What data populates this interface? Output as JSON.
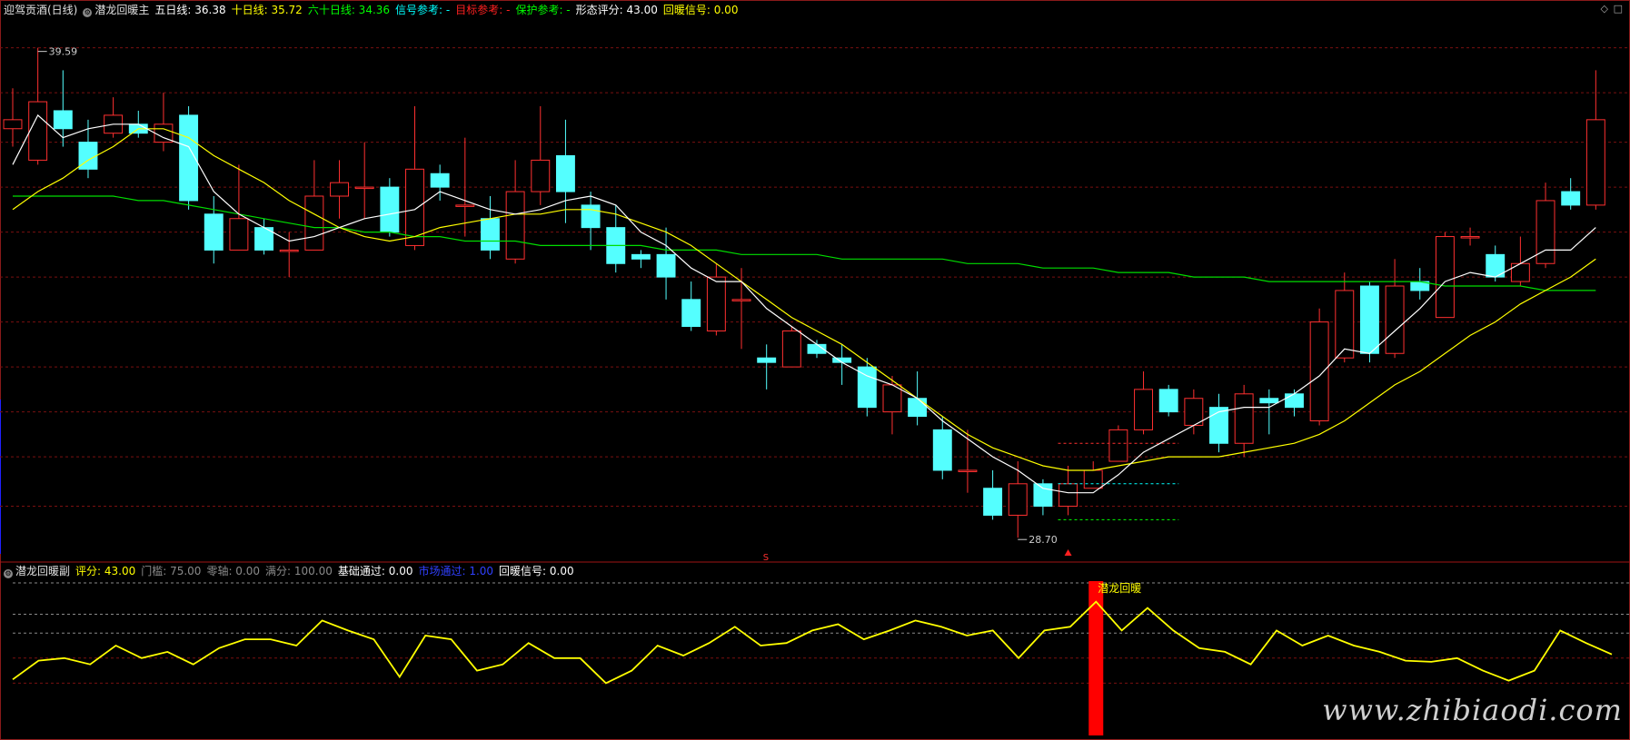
{
  "main_header": {
    "stock_name": "迎驾贡酒(日线)",
    "indicator_name": "潜龙回暖主",
    "items": [
      {
        "label": "五日线: 36.38",
        "color": "#ffffff"
      },
      {
        "label": "十日线: 35.72",
        "color": "#ffff00"
      },
      {
        "label": "六十日线: 34.36",
        "color": "#00ff00"
      },
      {
        "label": "信号参考: -",
        "color": "#00ffff"
      },
      {
        "label": "目标参考: -",
        "color": "#ff2020"
      },
      {
        "label": "保护参考: -",
        "color": "#00ff00"
      },
      {
        "label": "形态评分: 43.00",
        "color": "#ffffff"
      },
      {
        "label": "回暖信号: 0.00",
        "color": "#ffff00"
      }
    ]
  },
  "sub_header": {
    "indicator_name": "潜龙回暖副",
    "items": [
      {
        "label": "评分: 43.00",
        "color": "#ffff00"
      },
      {
        "label": "门槛: 75.00",
        "color": "#8a8a8a"
      },
      {
        "label": "零轴: 0.00",
        "color": "#8a8a8a"
      },
      {
        "label": "满分: 100.00",
        "color": "#8a8a8a"
      },
      {
        "label": "基础通过: 0.00",
        "color": "#ffffff"
      },
      {
        "label": "市场通过: 1.00",
        "color": "#3040ff"
      },
      {
        "label": "回暖信号: 0.00",
        "color": "#ffffff"
      }
    ]
  },
  "annotations": {
    "high_label": "39.59",
    "low_label": "28.70",
    "signal_label": "潜龙回暖",
    "s_marker": "S"
  },
  "watermark": "www.zhibiaodi.com",
  "colors": {
    "up": "#ff3030",
    "down": "#54ffff",
    "ma5": "#ffffff",
    "ma10": "#ffff00",
    "ma60": "#00dd00",
    "score": "#ffff00",
    "signal_bar": "#ff0000",
    "grid": "#7a1010"
  },
  "chart_data": [
    {
      "type": "candlestick",
      "title": "潜龙回暖主",
      "y_range": [
        28.3,
        40.3
      ],
      "candles": [
        [
          37.8,
          38.0,
          37.4,
          38.7
        ],
        [
          37.1,
          38.4,
          37.0,
          39.6
        ],
        [
          38.2,
          37.8,
          37.4,
          39.1
        ],
        [
          37.5,
          36.9,
          36.7,
          38.0
        ],
        [
          37.7,
          38.1,
          37.6,
          38.5
        ],
        [
          37.9,
          37.7,
          37.6,
          38.2
        ],
        [
          37.5,
          37.9,
          37.3,
          38.6
        ],
        [
          38.1,
          36.2,
          36.0,
          38.3
        ],
        [
          35.9,
          35.1,
          34.8,
          36.3
        ],
        [
          35.1,
          35.8,
          35.1,
          37.0
        ],
        [
          35.6,
          35.1,
          35.0,
          35.8
        ],
        [
          35.1,
          35.1,
          34.5,
          35.5
        ],
        [
          35.1,
          36.3,
          35.1,
          37.1
        ],
        [
          36.3,
          36.6,
          35.8,
          37.1
        ],
        [
          36.5,
          36.5,
          35.8,
          37.5
        ],
        [
          36.5,
          35.5,
          35.4,
          36.7
        ],
        [
          35.2,
          36.9,
          35.1,
          38.3
        ],
        [
          36.8,
          36.5,
          36.2,
          37.0
        ],
        [
          36.1,
          36.1,
          35.4,
          37.6
        ],
        [
          35.8,
          35.1,
          34.9,
          36.3
        ],
        [
          34.9,
          36.4,
          34.8,
          37.1
        ],
        [
          36.4,
          37.1,
          36.1,
          38.3
        ],
        [
          37.2,
          36.4,
          35.7,
          38.0
        ],
        [
          36.1,
          35.6,
          35.1,
          36.4
        ],
        [
          35.6,
          34.8,
          34.6,
          36.1
        ],
        [
          35.0,
          34.9,
          34.7,
          35.1
        ],
        [
          35.0,
          34.5,
          34.0,
          35.6
        ],
        [
          34.0,
          33.4,
          33.3,
          34.4
        ],
        [
          33.3,
          34.5,
          33.2,
          34.8
        ],
        [
          34.0,
          34.0,
          32.9,
          34.7
        ],
        [
          32.7,
          32.6,
          32.0,
          33.0
        ],
        [
          32.5,
          33.3,
          32.5,
          33.4
        ],
        [
          33.0,
          32.8,
          32.7,
          33.1
        ],
        [
          32.7,
          32.6,
          32.1,
          33.0
        ],
        [
          32.5,
          31.6,
          31.4,
          32.7
        ],
        [
          31.5,
          32.1,
          31.0,
          32.3
        ],
        [
          31.8,
          31.4,
          31.2,
          32.4
        ],
        [
          31.1,
          30.2,
          30.0,
          31.4
        ],
        [
          30.2,
          30.2,
          29.7,
          31.1
        ],
        [
          29.8,
          29.2,
          29.1,
          30.2
        ],
        [
          29.2,
          29.9,
          28.7,
          30.4
        ],
        [
          29.9,
          29.4,
          29.2,
          30.0
        ],
        [
          29.4,
          29.9,
          29.2,
          30.3
        ],
        [
          29.8,
          30.2,
          29.8,
          30.4
        ],
        [
          30.4,
          31.1,
          30.4,
          31.2
        ],
        [
          31.1,
          32.0,
          31.0,
          32.4
        ],
        [
          32.0,
          31.5,
          31.4,
          32.1
        ],
        [
          31.2,
          31.8,
          31.0,
          32.0
        ],
        [
          31.6,
          30.8,
          30.6,
          31.9
        ],
        [
          30.8,
          31.9,
          30.5,
          32.1
        ],
        [
          31.8,
          31.7,
          31.0,
          32.0
        ],
        [
          31.9,
          31.6,
          31.4,
          32.0
        ],
        [
          31.3,
          33.5,
          31.2,
          33.8
        ],
        [
          32.7,
          34.2,
          32.6,
          34.6
        ],
        [
          34.3,
          32.8,
          32.6,
          34.4
        ],
        [
          32.8,
          34.3,
          32.7,
          34.9
        ],
        [
          34.4,
          34.2,
          34.0,
          34.7
        ],
        [
          33.6,
          35.4,
          33.6,
          35.5
        ],
        [
          35.4,
          35.4,
          35.2,
          35.6
        ],
        [
          35.0,
          34.5,
          34.4,
          35.2
        ],
        [
          34.4,
          34.8,
          34.3,
          35.4
        ],
        [
          34.8,
          36.2,
          34.7,
          36.6
        ],
        [
          36.4,
          36.1,
          36.0,
          36.7
        ],
        [
          36.1,
          38.0,
          36.0,
          39.1
        ]
      ],
      "ma5": [
        37.0,
        38.1,
        37.6,
        37.8,
        37.9,
        37.9,
        37.6,
        37.4,
        36.4,
        35.9,
        35.6,
        35.3,
        35.4,
        35.6,
        35.8,
        35.9,
        36.0,
        36.4,
        36.2,
        36.0,
        35.9,
        36.0,
        36.2,
        36.3,
        36.1,
        35.5,
        35.2,
        34.7,
        34.4,
        34.4,
        33.8,
        33.4,
        33.0,
        32.6,
        32.3,
        32.1,
        31.8,
        31.3,
        30.9,
        30.5,
        30.2,
        29.8,
        29.7,
        29.7,
        30.1,
        30.6,
        30.9,
        31.2,
        31.5,
        31.6,
        31.6,
        31.9,
        32.3,
        32.9,
        32.8,
        33.3,
        33.8,
        34.4,
        34.6,
        34.5,
        34.8,
        35.1,
        35.1,
        35.6
      ],
      "ma10": [
        36.0,
        36.4,
        36.7,
        37.1,
        37.4,
        37.8,
        37.8,
        37.6,
        37.2,
        36.9,
        36.6,
        36.2,
        35.9,
        35.6,
        35.4,
        35.3,
        35.4,
        35.6,
        35.7,
        35.8,
        35.9,
        35.9,
        36.0,
        36.0,
        35.9,
        35.7,
        35.5,
        35.2,
        34.8,
        34.4,
        34.0,
        33.6,
        33.3,
        33.0,
        32.6,
        32.2,
        31.8,
        31.4,
        31.0,
        30.7,
        30.5,
        30.3,
        30.2,
        30.2,
        30.3,
        30.4,
        30.5,
        30.5,
        30.5,
        30.6,
        30.7,
        30.8,
        31.0,
        31.3,
        31.7,
        32.1,
        32.4,
        32.8,
        33.2,
        33.5,
        33.9,
        34.2,
        34.5,
        34.9
      ],
      "ma60": [
        36.3,
        36.3,
        36.3,
        36.3,
        36.3,
        36.2,
        36.2,
        36.1,
        36.0,
        35.9,
        35.8,
        35.7,
        35.6,
        35.6,
        35.5,
        35.5,
        35.4,
        35.4,
        35.3,
        35.3,
        35.3,
        35.2,
        35.2,
        35.2,
        35.2,
        35.2,
        35.1,
        35.1,
        35.1,
        35.0,
        35.0,
        35.0,
        35.0,
        34.9,
        34.9,
        34.9,
        34.9,
        34.9,
        34.8,
        34.8,
        34.8,
        34.7,
        34.7,
        34.7,
        34.6,
        34.6,
        34.6,
        34.5,
        34.5,
        34.5,
        34.4,
        34.4,
        34.4,
        34.4,
        34.4,
        34.4,
        34.4,
        34.3,
        34.3,
        34.3,
        34.3,
        34.2,
        34.2,
        34.2
      ],
      "level_lines": [
        {
          "price": 30.8,
          "color": "#ff3030",
          "from": 42,
          "to": 46
        },
        {
          "price": 29.9,
          "color": "#00ffff",
          "from": 42,
          "to": 46
        },
        {
          "price": 29.1,
          "color": "#00ff00",
          "from": 42,
          "to": 46
        }
      ],
      "gridlines": [
        39.6,
        38.6,
        37.5,
        36.5,
        35.5,
        34.5,
        33.5,
        32.5,
        31.5,
        30.5,
        29.4
      ]
    },
    {
      "type": "line",
      "title": "潜龙回暖副",
      "y_range": [
        0,
        100
      ],
      "score": [
        23,
        38,
        40,
        35,
        50,
        40,
        45,
        35,
        48,
        55,
        55,
        50,
        70,
        62,
        55,
        25,
        58,
        55,
        30,
        35,
        52,
        40,
        40,
        20,
        30,
        50,
        42,
        52,
        65,
        50,
        52,
        62,
        67,
        55,
        62,
        70,
        65,
        58,
        62,
        40,
        62,
        65,
        85,
        62,
        80,
        62,
        48,
        45,
        35,
        62,
        50,
        58,
        50,
        45,
        38,
        37,
        40,
        30,
        22,
        30,
        62,
        52,
        43
      ],
      "signal_index": 42,
      "threshold_lines": [
        100,
        75,
        60
      ],
      "grid_lines": [
        40,
        20
      ]
    }
  ]
}
